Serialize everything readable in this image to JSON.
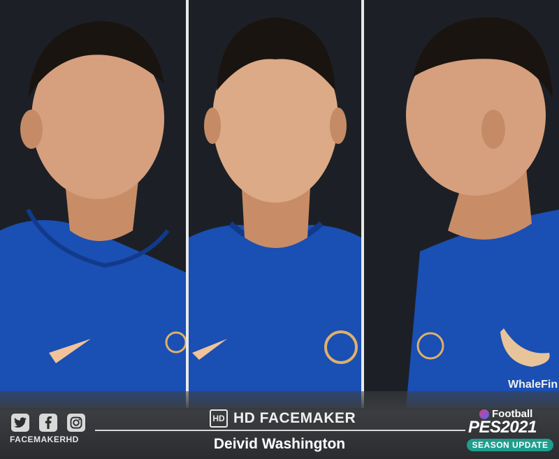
{
  "social": {
    "icons": [
      "twitter-icon",
      "facebook-icon",
      "instagram-icon"
    ],
    "handle": "FACEMAKERHD"
  },
  "brand": {
    "logo_text": "HD",
    "title": "HD FACEMAKER"
  },
  "player": {
    "name": "Deivid Washington"
  },
  "game": {
    "efootball": "Football",
    "pes": "PES2021",
    "season_badge": "SEASON UPDATE"
  },
  "kit": {
    "sponsor": "WhaleFin"
  },
  "colors": {
    "kit_blue": "#1a4fb3",
    "skin": "#d9a07c",
    "hair": "#1a1410",
    "badge_teal": "#1f9d8e"
  }
}
